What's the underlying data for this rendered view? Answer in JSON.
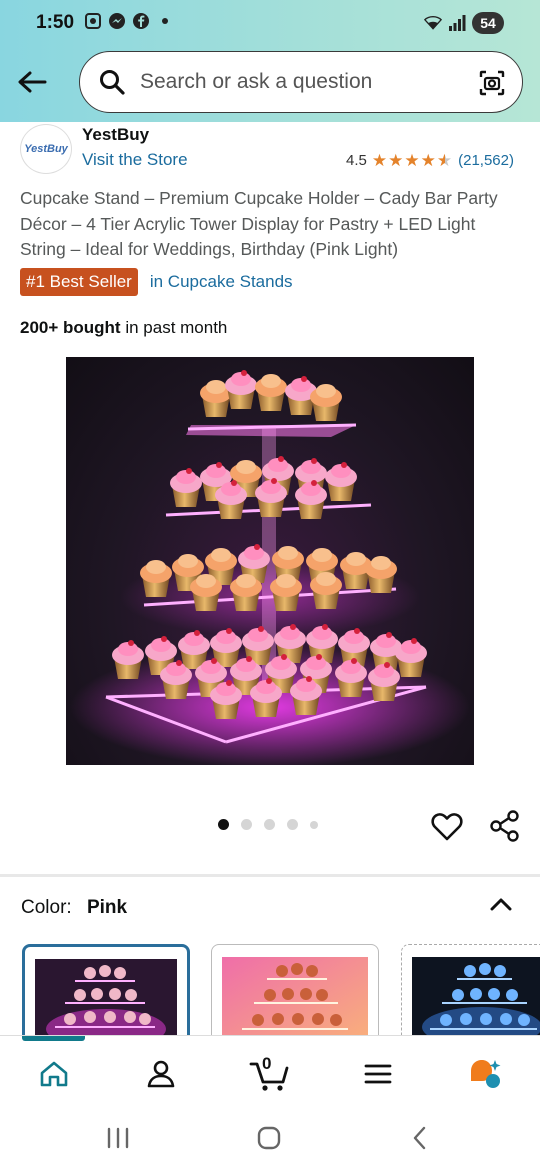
{
  "status_bar": {
    "time": "1:50",
    "battery": "54",
    "network": "6E"
  },
  "search": {
    "placeholder": "Search or ask a question"
  },
  "store": {
    "logo_text": "YestBuy",
    "name": "YestBuy",
    "visit_label": "Visit the Store"
  },
  "rating": {
    "value": "4.5",
    "stars": 4.5,
    "count": "(21,562)"
  },
  "product": {
    "title": "Cupcake Stand – Premium Cupcake Holder – Cady Bar Party Décor – 4 Tier Acrylic Tower Display for Pastry + LED Light String – Ideal for Weddings, Birthday (Pink Light)",
    "badge": "#1 Best Seller",
    "badge_category": "in Cupcake Stands",
    "bought_bold": "200+ bought",
    "bought_rest": " in past month"
  },
  "carousel": {
    "count": 5,
    "active_index": 0
  },
  "color_selector": {
    "label": "Color:",
    "value": "Pink"
  },
  "variants": [
    {
      "name": "Pink",
      "selected": true
    },
    {
      "name": "Warm",
      "selected": false
    },
    {
      "name": "Blue",
      "selected": false
    }
  ],
  "bottom_nav": {
    "cart_count": "0",
    "items": [
      "home-icon",
      "account-icon",
      "cart-icon",
      "menu-icon",
      "rufus-icon"
    ]
  },
  "colors": {
    "link": "#1b6c9e",
    "badge": "#c7511f",
    "star": "#e4832b",
    "accent": "#117a8b"
  }
}
